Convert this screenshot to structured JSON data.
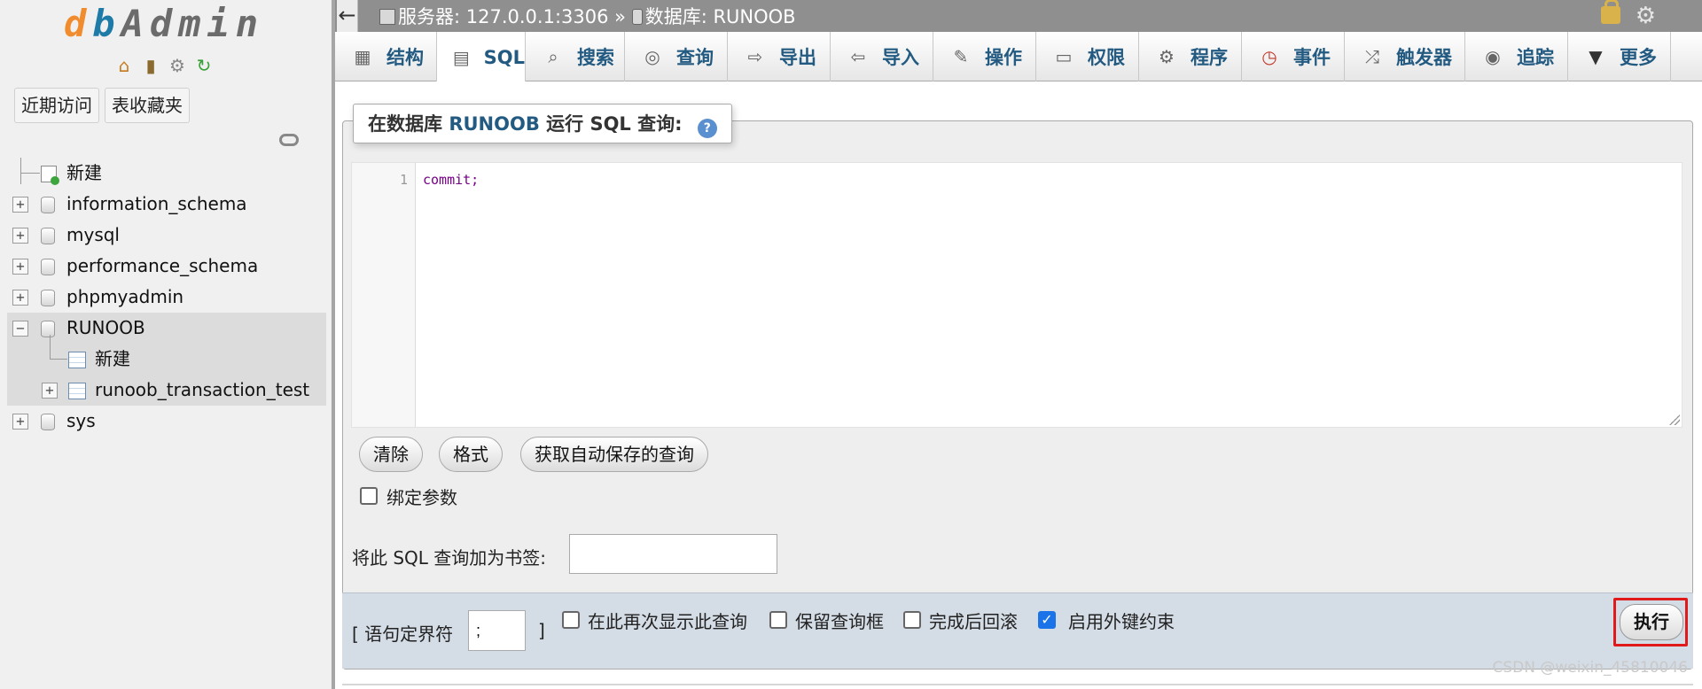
{
  "nav": {
    "logo": {
      "d": "d",
      "b": "b",
      "rest": "Admin"
    },
    "icons": [
      "home-icon",
      "exit-icon",
      "settings-icon",
      "reload-icon"
    ],
    "recent_label": "近期访问",
    "favorites_label": "表收藏夹",
    "tree": [
      {
        "label": "新建",
        "type": "new"
      },
      {
        "label": "information_schema",
        "type": "db"
      },
      {
        "label": "mysql",
        "type": "db"
      },
      {
        "label": "performance_schema",
        "type": "db"
      },
      {
        "label": "phpmyadmin",
        "type": "db"
      },
      {
        "label": "RUNOOB",
        "type": "db",
        "expanded": true,
        "selected": true
      },
      {
        "label": "新建",
        "type": "new",
        "child": true
      },
      {
        "label": "runoob_transaction_test",
        "type": "table",
        "child": true
      },
      {
        "label": "sys",
        "type": "db"
      }
    ]
  },
  "topbar": {
    "back": "←",
    "server_label": "服务器: 127.0.0.1:3306",
    "separator": "»",
    "db_label": "数据库: RUNOOB"
  },
  "tabs": [
    {
      "label": "结构",
      "icon": "structure-icon"
    },
    {
      "label": "SQL",
      "icon": "sql-icon",
      "active": true
    },
    {
      "label": "搜索",
      "icon": "search-icon"
    },
    {
      "label": "查询",
      "icon": "query-icon"
    },
    {
      "label": "导出",
      "icon": "export-icon"
    },
    {
      "label": "导入",
      "icon": "import-icon"
    },
    {
      "label": "操作",
      "icon": "wrench-icon"
    },
    {
      "label": "权限",
      "icon": "privileges-icon"
    },
    {
      "label": "程序",
      "icon": "routines-icon"
    },
    {
      "label": "事件",
      "icon": "clock-icon"
    },
    {
      "label": "触发器",
      "icon": "trigger-icon"
    },
    {
      "label": "追踪",
      "icon": "eye-icon"
    },
    {
      "label": "更多",
      "icon": "caret-down-icon"
    }
  ],
  "query": {
    "legend_prefix": "在数据库",
    "db_name": "RUNOOB",
    "legend_suffix": "运行 SQL 查询:",
    "help_glyph": "?",
    "line_number": "1",
    "code": "commit;",
    "clear_label": "清除",
    "format_label": "格式",
    "autosave_label": "获取自动保存的查询",
    "bind_params_label": "绑定参数",
    "bookmark_label": "将此 SQL 查询加为书签:",
    "bookmark_value": ""
  },
  "options": {
    "delimiter_open": "[ 语句定界符",
    "delimiter_value": ";",
    "delimiter_close": "]",
    "show_again_label": "在此再次显示此查询",
    "keep_box_label": "保留查询框",
    "rollback_label": "完成后回滚",
    "fk_checks_label": "启用外键约束",
    "fk_checks_checked": true,
    "go_label": "执行"
  },
  "watermark": "CSDN @weixin_45810046",
  "colors": {
    "accent": "#235a81",
    "highlight": "#e01a1a",
    "checkbox": "#1a73e8"
  }
}
